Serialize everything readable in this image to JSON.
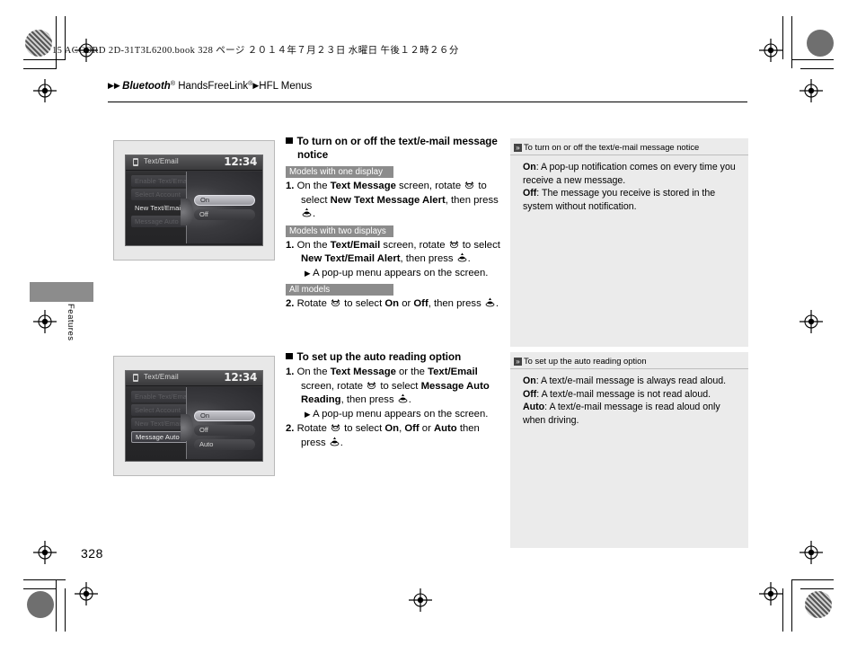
{
  "header": {
    "filebar": "15 ACCORD 2D-31T3L6200.book   328 ページ   ２０１４年７月２３日   水曜日   午後１２時２６分",
    "breadcrumb": {
      "arrow1": "▶",
      "arrow2": "▶",
      "arrow3": "▶",
      "part1": "Bluetooth",
      "sup1": "®",
      "part2": "HandsFreeLink",
      "sup2": "®",
      "part3": "HFL Menus"
    }
  },
  "side_tab": {
    "label": "Features"
  },
  "page_number": "328",
  "figures": [
    {
      "name": "text-email-alert-screen",
      "title": "Text/Email",
      "clock": "12:34",
      "menu_items": [
        {
          "label": "Enable Text/Email",
          "state": "dim"
        },
        {
          "label": "Select Account",
          "state": "dim"
        },
        {
          "label": "New Text/Email Alert",
          "state": "plain"
        },
        {
          "label": "Message Auto Read",
          "state": "dim"
        }
      ],
      "popup_options": [
        {
          "label": "On",
          "highlighted": true
        },
        {
          "label": "Off",
          "highlighted": false
        }
      ]
    },
    {
      "name": "message-auto-read-screen",
      "title": "Text/Email",
      "clock": "12:34",
      "menu_items": [
        {
          "label": "Enable Text/Email",
          "state": "dim"
        },
        {
          "label": "Select Account",
          "state": "dim"
        },
        {
          "label": "New Text/Email Alert",
          "state": "dim"
        },
        {
          "label": "Message Auto Read",
          "state": "sel"
        }
      ],
      "popup_options": [
        {
          "label": "On",
          "highlighted": true
        },
        {
          "label": "Off",
          "highlighted": false
        },
        {
          "label": "Auto",
          "highlighted": false
        }
      ]
    }
  ],
  "sections": {
    "notice": {
      "heading": "To turn on or off the text/e-mail message notice",
      "badge_one_display": "Models with one display",
      "badge_two_displays": "Models with two displays",
      "badge_all_models": "All models",
      "step1a": {
        "num": "1.",
        "t1": "On the ",
        "b1": "Text Message",
        "t2": " screen, rotate ",
        "icon1": "rotary-knob-rotate-icon",
        "t3": " to select ",
        "b2": "New Text Message Alert",
        "t4": ", then press ",
        "icon2": "rotary-knob-press-icon",
        "t5": "."
      },
      "step1b": {
        "num": "1.",
        "t1": "On the ",
        "b1": "Text/Email",
        "t2": " screen, rotate ",
        "icon1": "rotary-knob-rotate-icon",
        "t3": " to select ",
        "b2": "New Text/Email Alert",
        "t4": ", then press ",
        "icon2": "rotary-knob-press-icon",
        "t5": "."
      },
      "popup_note": "A pop-up menu appears on the screen.",
      "step2": {
        "num": "2.",
        "t1": "Rotate ",
        "icon1": "rotary-knob-rotate-icon",
        "t2": " to select ",
        "b1": "On",
        "t3": " or ",
        "b2": "Off",
        "t4": ", then press ",
        "icon2": "rotary-knob-press-icon",
        "t5": "."
      }
    },
    "autoread": {
      "heading": "To set up the auto reading option",
      "step1": {
        "num": "1.",
        "t1": "On the ",
        "b1": "Text Message",
        "t2": " or the ",
        "b2": "Text/Email",
        "t3": " screen, rotate ",
        "icon1": "rotary-knob-rotate-icon",
        "t4": " to select ",
        "b3": "Message Auto Reading",
        "t5": ", then press ",
        "icon2": "rotary-knob-press-icon",
        "t6": "."
      },
      "popup_note": "A pop-up menu appears on the screen.",
      "step2": {
        "num": "2.",
        "t1": "Rotate ",
        "icon1": "rotary-knob-rotate-icon",
        "t2": " to select ",
        "b1": "On",
        "t3": ", ",
        "b2": "Off",
        "t4": " or ",
        "b3": "Auto",
        "t5": " then press ",
        "icon2": "rotary-knob-press-icon",
        "t6": "."
      }
    }
  },
  "panels": [
    {
      "name": "notice-info-panel",
      "heading": "To turn on or off the text/e-mail message notice",
      "lines": [
        {
          "term": "On",
          "sep": ": ",
          "text": "A pop-up notification comes on every time you receive a new message."
        },
        {
          "term": "Off",
          "sep": ": ",
          "text": "The message you receive is stored in the system without notification."
        }
      ]
    },
    {
      "name": "autoread-info-panel",
      "heading": "To set up the auto reading option",
      "lines": [
        {
          "term": "On",
          "sep": ": ",
          "text": "A text/e-mail message is always read aloud."
        },
        {
          "term": "Off",
          "sep": ": ",
          "text": "A text/e-mail message is not read aloud."
        },
        {
          "term": "Auto",
          "sep": ": ",
          "text": "A text/e-mail message is read aloud only when driving."
        }
      ]
    }
  ],
  "triangle": "▶",
  "chevron": "»",
  "colors": {
    "badge_gray": "#8c8c8c",
    "panel_gray": "#ebebeb",
    "rule_black": "#000000"
  }
}
